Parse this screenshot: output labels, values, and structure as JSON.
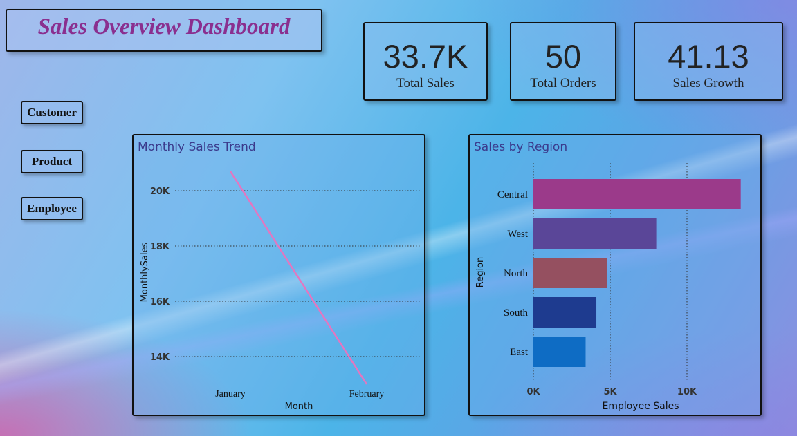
{
  "title": "Sales Overview Dashboard",
  "kpis": [
    {
      "value": "33.7K",
      "label": "Total Sales"
    },
    {
      "value": "50",
      "label": "Total Orders"
    },
    {
      "value": "41.13",
      "label": "Sales Growth"
    }
  ],
  "nav": {
    "customer": "Customer",
    "product": "Product",
    "employee": "Employee"
  },
  "colors": {
    "title": "#8a2f8f",
    "trend_line": "#e476c0",
    "central": "#9b3a8a",
    "west": "#5a4698",
    "north": "#955060",
    "south": "#1e3b8f",
    "east": "#0e6cc4"
  },
  "chart_data": [
    {
      "type": "line",
      "title": "Monthly Sales Trend",
      "xlabel": "Month",
      "ylabel": "MonthlySales",
      "x": [
        "January",
        "February"
      ],
      "series": [
        {
          "values": [
            20700,
            13000
          ]
        }
      ],
      "yticks": [
        "14K",
        "16K",
        "18K",
        "20K"
      ],
      "ytick_values": [
        14000,
        16000,
        18000,
        20000
      ],
      "ylim": [
        13000,
        20700
      ],
      "grid": true
    },
    {
      "type": "bar",
      "orientation": "horizontal",
      "title": "Sales by Region",
      "xlabel": "Employee Sales",
      "ylabel": "Region",
      "categories": [
        "Central",
        "West",
        "North",
        "South",
        "East"
      ],
      "values": [
        13500,
        8000,
        4800,
        4100,
        3400
      ],
      "xticks": [
        "0K",
        "5K",
        "10K"
      ],
      "xtick_values": [
        0,
        5000,
        10000
      ],
      "xlim": [
        0,
        15000
      ],
      "grid": true
    }
  ]
}
